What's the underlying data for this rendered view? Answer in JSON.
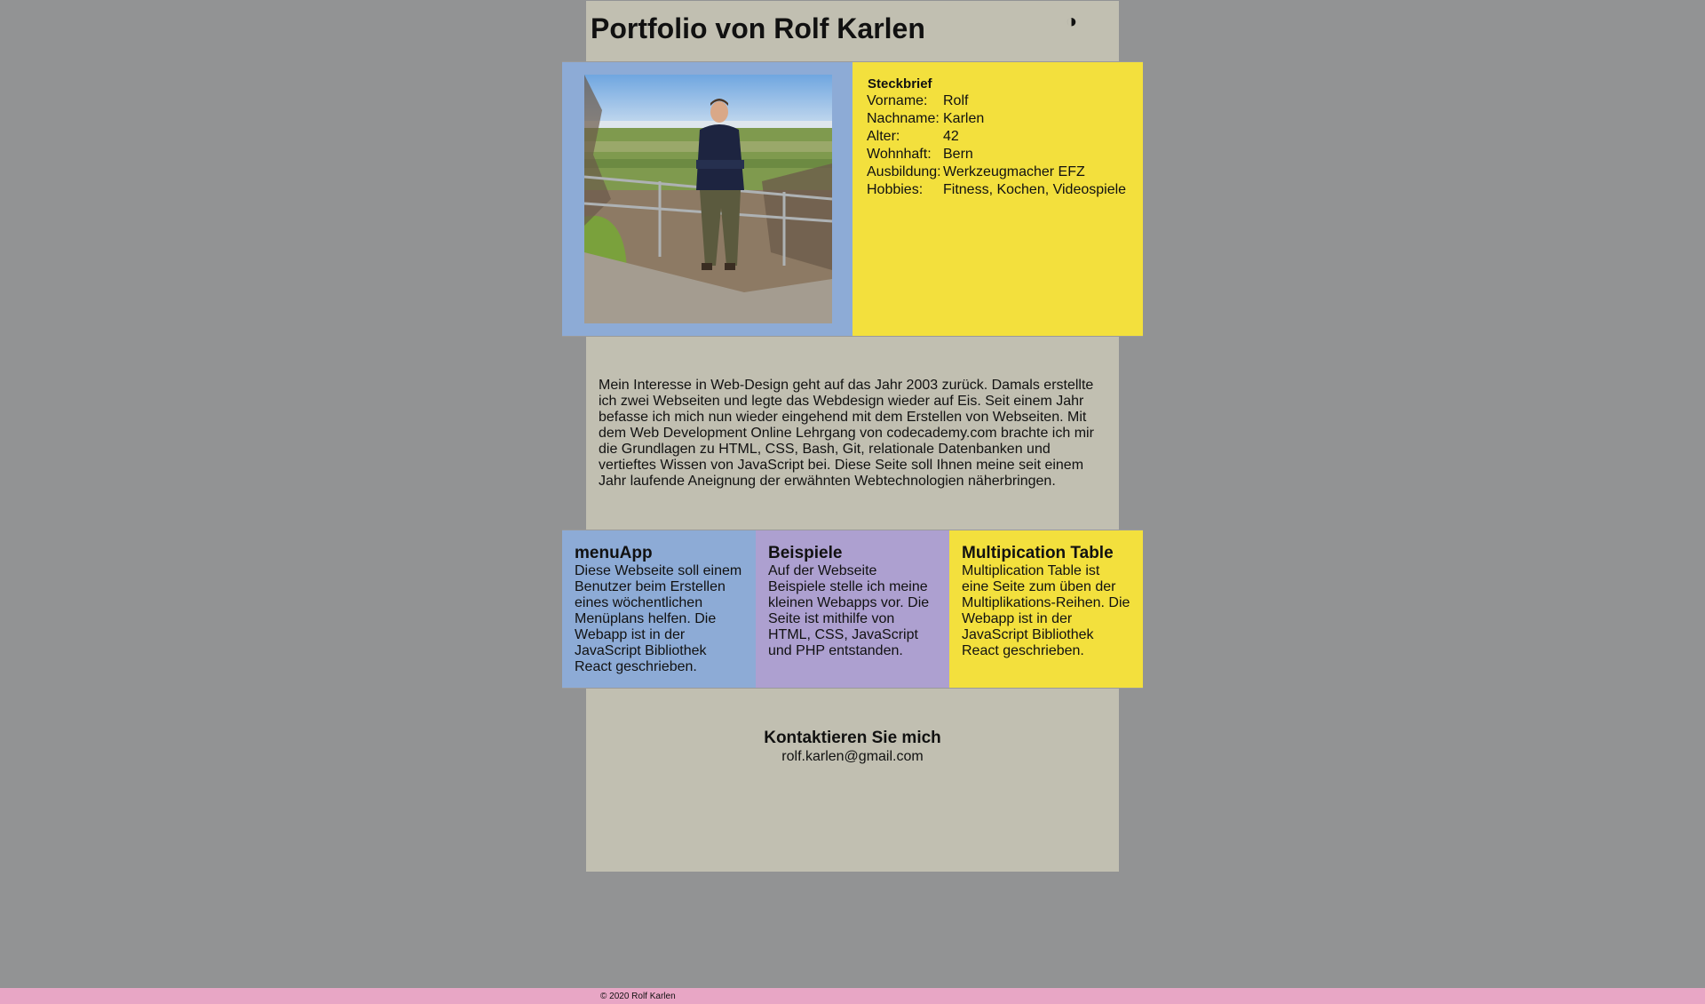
{
  "header": {
    "title": "Portfolio von Rolf Karlen",
    "theme_toggle_glyph": "◑"
  },
  "profile": {
    "photo_icon": "person-photo",
    "card_title": "Steckbrief",
    "rows": [
      {
        "label": "Vorname:",
        "value": "Rolf"
      },
      {
        "label": "Nachname:",
        "value": "Karlen"
      },
      {
        "label": "Alter:",
        "value": "42"
      },
      {
        "label": "Wohnhaft:",
        "value": "Bern"
      },
      {
        "label": "Ausbildung:",
        "value": "Werkzeugmacher EFZ"
      },
      {
        "label": "Hobbies:",
        "value": "Fitness, Kochen, Videospiele"
      }
    ]
  },
  "intro": {
    "text": "Mein Interesse in Web-Design geht auf das Jahr 2003 zurück. Damals erstellte ich zwei Webseiten und legte das Webdesign wieder auf Eis. Seit einem Jahr befasse ich mich nun wieder eingehend mit dem Erstellen von Webseiten. Mit dem Web Development Online Lehrgang von codecademy.com brachte ich mir die Grundlagen zu HTML, CSS, Bash, Git, relationale Datenbanken und vertieftes Wissen von JavaScript bei. Diese Seite soll Ihnen meine seit einem Jahr laufende Aneignung der erwähnten Webtechnologien näherbringen."
  },
  "projects": [
    {
      "title": "menuApp",
      "text": "Diese Webseite soll einem Benutzer beim Erstellen eines wöchentlichen Menüplans helfen. Die Webapp ist in der JavaScript Bibliothek React geschrieben.",
      "color": "#8dabd6"
    },
    {
      "title": "Beispiele",
      "text": "Auf der Webseite Beispiele stelle ich meine kleinen Webapps vor. Die Seite ist mithilfe von HTML, CSS, JavaScript und PHP entstanden.",
      "color": "#ada0d0"
    },
    {
      "title": "Multipication Table",
      "text": "Multiplication Table ist eine Seite zum üben der Multiplikations-Reihen. Die Webapp ist in der JavaScript Bibliothek React geschrieben.",
      "color": "#f3e03d"
    }
  ],
  "contact": {
    "heading": "Kontaktieren Sie mich",
    "email": "rolf.karlen@gmail.com"
  },
  "footer": {
    "text": "© 2020 Rolf Karlen"
  },
  "colors": {
    "background": "#929394",
    "page": "#c1bfb1",
    "blue": "#8dabd6",
    "purple": "#ada0d0",
    "yellow": "#f3e03d",
    "footer": "#e8a6c5"
  }
}
